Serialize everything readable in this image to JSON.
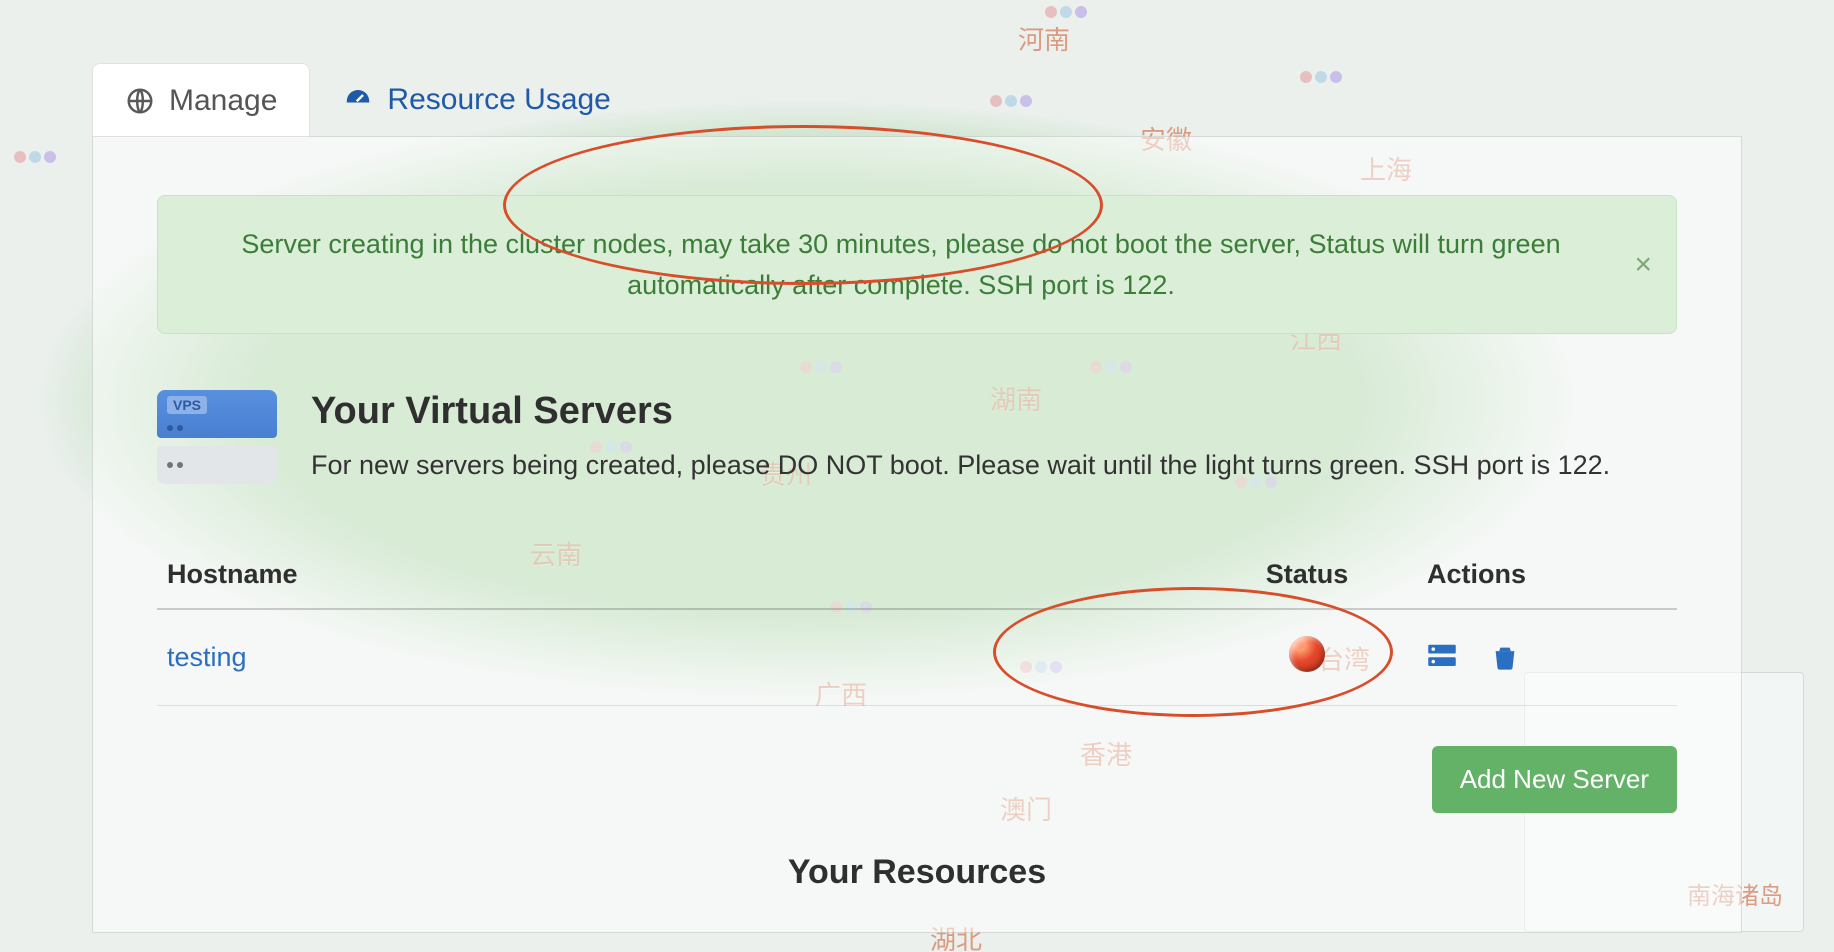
{
  "tabs": {
    "manage": {
      "label": "Manage"
    },
    "resource_usage": {
      "label": "Resource Usage"
    }
  },
  "alert": {
    "message": "Server creating in the cluster nodes, may take 30 minutes, please do not boot the server, Status will turn green automatically after complete. SSH port is 122."
  },
  "section": {
    "title": "Your Virtual Servers",
    "subtitle": "For new servers being created, please DO NOT boot. Please wait until the light turns green. SSH port is 122."
  },
  "table": {
    "headers": {
      "hostname": "Hostname",
      "status": "Status",
      "actions": "Actions"
    },
    "rows": [
      {
        "hostname": "testing",
        "status": "red"
      }
    ]
  },
  "buttons": {
    "add_new_server": "Add New Server"
  },
  "subsection": {
    "your_resources": "Your Resources"
  },
  "map_labels": {
    "henan": "河南",
    "anhui": "安徽",
    "jiangxi": "江西",
    "hunan": "湖南",
    "guangxi": "广西",
    "guizhou": "贵州",
    "yunnan": "云南",
    "shanghai": "上海",
    "taiwan": "台湾",
    "xianggang": "香港",
    "aomen": "澳门",
    "hubei": "湖北",
    "south_islands": "南海诸岛"
  }
}
